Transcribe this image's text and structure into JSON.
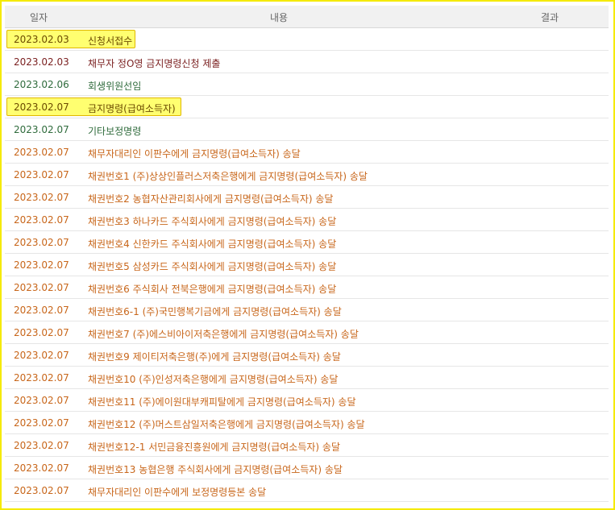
{
  "header": {
    "date": "일자",
    "content": "내용",
    "result": "결과"
  },
  "rows": [
    {
      "date": "2023.02.03",
      "content": "신청서접수",
      "color": "#6b4a00",
      "highlight": true
    },
    {
      "date": "2023.02.03",
      "content": "채무자 정O영 금지명령신청 제출",
      "color": "#7a1f1f",
      "highlight": false
    },
    {
      "date": "2023.02.06",
      "content": "회생위원선임",
      "color": "#2f6b3c",
      "highlight": false
    },
    {
      "date": "2023.02.07",
      "content": "금지명령(급여소득자)",
      "color": "#6b4a00",
      "highlight": true
    },
    {
      "date": "2023.02.07",
      "content": "기타보정명령",
      "color": "#2f6b3c",
      "highlight": false
    },
    {
      "date": "2023.02.07",
      "content": "채무자대리인 이판수에게 금지명령(급여소득자) 송달",
      "color": "#c8661a",
      "highlight": false
    },
    {
      "date": "2023.02.07",
      "content": "채권번호1 (주)상상인플러스저축은행에게 금지명령(급여소득자) 송달",
      "color": "#c8661a",
      "highlight": false
    },
    {
      "date": "2023.02.07",
      "content": "채권번호2 농협자산관리회사에게 금지명령(급여소득자) 송달",
      "color": "#c8661a",
      "highlight": false
    },
    {
      "date": "2023.02.07",
      "content": "채권번호3 하나카드 주식회사에게 금지명령(급여소득자) 송달",
      "color": "#c8661a",
      "highlight": false
    },
    {
      "date": "2023.02.07",
      "content": "채권번호4 신한카드 주식회사에게 금지명령(급여소득자) 송달",
      "color": "#c8661a",
      "highlight": false
    },
    {
      "date": "2023.02.07",
      "content": "채권번호5 삼성카드 주식회사에게 금지명령(급여소득자) 송달",
      "color": "#c8661a",
      "highlight": false
    },
    {
      "date": "2023.02.07",
      "content": "채권번호6 주식회사 전북은행에게 금지명령(급여소득자) 송달",
      "color": "#c8661a",
      "highlight": false
    },
    {
      "date": "2023.02.07",
      "content": "채권번호6-1 (주)국민행복기금에게 금지명령(급여소득자) 송달",
      "color": "#c8661a",
      "highlight": false
    },
    {
      "date": "2023.02.07",
      "content": "채권번호7 (주)에스비아이저축은행에게 금지명령(급여소득자) 송달",
      "color": "#c8661a",
      "highlight": false
    },
    {
      "date": "2023.02.07",
      "content": "채권번호9 제이티저축은행(주)에게 금지명령(급여소득자) 송달",
      "color": "#c8661a",
      "highlight": false
    },
    {
      "date": "2023.02.07",
      "content": "채권번호10 (주)인성저축은행에게 금지명령(급여소득자) 송달",
      "color": "#c8661a",
      "highlight": false
    },
    {
      "date": "2023.02.07",
      "content": "채권번호11 (주)에이원대부캐피탈에게 금지명령(급여소득자) 송달",
      "color": "#c8661a",
      "highlight": false
    },
    {
      "date": "2023.02.07",
      "content": "채권번호12 (주)머스트삼일저축은행에게 금지명령(급여소득자) 송달",
      "color": "#c8661a",
      "highlight": false
    },
    {
      "date": "2023.02.07",
      "content": "채권번호12-1 서민금융진흥원에게 금지명령(급여소득자) 송달",
      "color": "#c8661a",
      "highlight": false
    },
    {
      "date": "2023.02.07",
      "content": "채권번호13 농협은행 주식회사에게 금지명령(급여소득자) 송달",
      "color": "#c8661a",
      "highlight": false
    },
    {
      "date": "2023.02.07",
      "content": "채무자대리인 이판수에게 보정명령등본 송달",
      "color": "#c8661a",
      "highlight": false
    }
  ]
}
